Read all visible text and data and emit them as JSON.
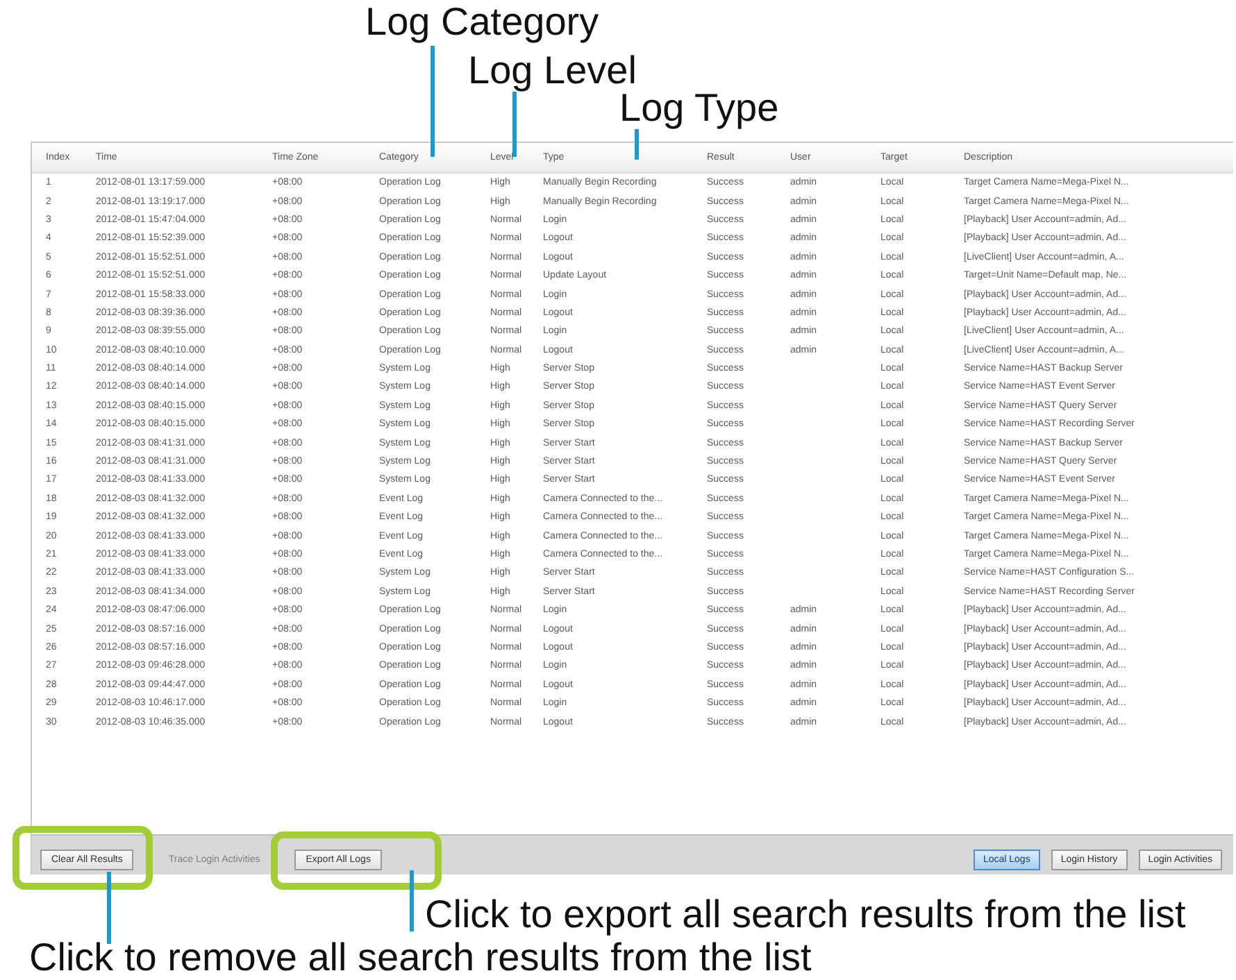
{
  "callouts": [
    {
      "text": "Log Category"
    },
    {
      "text": "Log Level"
    },
    {
      "text": "Log Type"
    }
  ],
  "table": {
    "columns": [
      "Index",
      "Time",
      "Time Zone",
      "Category",
      "Level",
      "Type",
      "Result",
      "User",
      "Target",
      "Description"
    ],
    "rows": [
      {
        "index": "1",
        "time": "2012-08-01 13:17:59.000",
        "time_zone": "+08:00",
        "category": "Operation Log",
        "level": "High",
        "type": "Manually Begin Recording",
        "result": "Success",
        "user": "admin",
        "target": "Local",
        "description": "Target Camera Name=Mega-Pixel N..."
      },
      {
        "index": "2",
        "time": "2012-08-01 13:19:17.000",
        "time_zone": "+08:00",
        "category": "Operation Log",
        "level": "High",
        "type": "Manually Begin Recording",
        "result": "Success",
        "user": "admin",
        "target": "Local",
        "description": "Target Camera Name=Mega-Pixel N..."
      },
      {
        "index": "3",
        "time": "2012-08-01 15:47:04.000",
        "time_zone": "+08:00",
        "category": "Operation Log",
        "level": "Normal",
        "type": "Login",
        "result": "Success",
        "user": "admin",
        "target": "Local",
        "description": "[Playback] User Account=admin, Ad..."
      },
      {
        "index": "4",
        "time": "2012-08-01 15:52:39.000",
        "time_zone": "+08:00",
        "category": "Operation Log",
        "level": "Normal",
        "type": "Logout",
        "result": "Success",
        "user": "admin",
        "target": "Local",
        "description": "[Playback] User Account=admin, Ad..."
      },
      {
        "index": "5",
        "time": "2012-08-01 15:52:51.000",
        "time_zone": "+08:00",
        "category": "Operation Log",
        "level": "Normal",
        "type": "Logout",
        "result": "Success",
        "user": "admin",
        "target": "Local",
        "description": "[LiveClient] User Account=admin, A..."
      },
      {
        "index": "6",
        "time": "2012-08-01 15:52:51.000",
        "time_zone": "+08:00",
        "category": "Operation Log",
        "level": "Normal",
        "type": "Update Layout",
        "result": "Success",
        "user": "admin",
        "target": "Local",
        "description": "Target=Unit Name=Default map, Ne..."
      },
      {
        "index": "7",
        "time": "2012-08-01 15:58:33.000",
        "time_zone": "+08:00",
        "category": "Operation Log",
        "level": "Normal",
        "type": "Login",
        "result": "Success",
        "user": "admin",
        "target": "Local",
        "description": "[Playback] User Account=admin, Ad..."
      },
      {
        "index": "8",
        "time": "2012-08-03 08:39:36.000",
        "time_zone": "+08:00",
        "category": "Operation Log",
        "level": "Normal",
        "type": "Logout",
        "result": "Success",
        "user": "admin",
        "target": "Local",
        "description": "[Playback] User Account=admin, Ad..."
      },
      {
        "index": "9",
        "time": "2012-08-03 08:39:55.000",
        "time_zone": "+08:00",
        "category": "Operation Log",
        "level": "Normal",
        "type": "Login",
        "result": "Success",
        "user": "admin",
        "target": "Local",
        "description": "[LiveClient] User Account=admin, A..."
      },
      {
        "index": "10",
        "time": "2012-08-03 08:40:10.000",
        "time_zone": "+08:00",
        "category": "Operation Log",
        "level": "Normal",
        "type": "Logout",
        "result": "Success",
        "user": "admin",
        "target": "Local",
        "description": "[LiveClient] User Account=admin, A..."
      },
      {
        "index": "11",
        "time": "2012-08-03 08:40:14.000",
        "time_zone": "+08:00",
        "category": "System Log",
        "level": "High",
        "type": "Server Stop",
        "result": "Success",
        "target": "Local",
        "description": "Service Name=HAST Backup Server"
      },
      {
        "index": "12",
        "time": "2012-08-03 08:40:14.000",
        "time_zone": "+08:00",
        "category": "System Log",
        "level": "High",
        "type": "Server Stop",
        "result": "Success",
        "target": "Local",
        "description": "Service Name=HAST Event Server"
      },
      {
        "index": "13",
        "time": "2012-08-03 08:40:15.000",
        "time_zone": "+08:00",
        "category": "System Log",
        "level": "High",
        "type": "Server Stop",
        "result": "Success",
        "target": "Local",
        "description": "Service Name=HAST Query Server"
      },
      {
        "index": "14",
        "time": "2012-08-03 08:40:15.000",
        "time_zone": "+08:00",
        "category": "System Log",
        "level": "High",
        "type": "Server Stop",
        "result": "Success",
        "target": "Local",
        "description": "Service Name=HAST Recording Server"
      },
      {
        "index": "15",
        "time": "2012-08-03 08:41:31.000",
        "time_zone": "+08:00",
        "category": "System Log",
        "level": "High",
        "type": "Server Start",
        "result": "Success",
        "target": "Local",
        "description": "Service Name=HAST Backup Server"
      },
      {
        "index": "16",
        "time": "2012-08-03 08:41:31.000",
        "time_zone": "+08:00",
        "category": "System Log",
        "level": "High",
        "type": "Server Start",
        "result": "Success",
        "target": "Local",
        "description": "Service Name=HAST Query Server"
      },
      {
        "index": "17",
        "time": "2012-08-03 08:41:33.000",
        "time_zone": "+08:00",
        "category": "System Log",
        "level": "High",
        "type": "Server Start",
        "result": "Success",
        "target": "Local",
        "description": "Service Name=HAST Event Server"
      },
      {
        "index": "18",
        "time": "2012-08-03 08:41:32.000",
        "time_zone": "+08:00",
        "category": "Event Log",
        "level": "High",
        "type": "Camera Connected to the...",
        "result": "Success",
        "target": "Local",
        "description": "Target Camera Name=Mega-Pixel N..."
      },
      {
        "index": "19",
        "time": "2012-08-03 08:41:32.000",
        "time_zone": "+08:00",
        "category": "Event Log",
        "level": "High",
        "type": "Camera Connected to the...",
        "result": "Success",
        "target": "Local",
        "description": "Target Camera Name=Mega-Pixel N..."
      },
      {
        "index": "20",
        "time": "2012-08-03 08:41:33.000",
        "time_zone": "+08:00",
        "category": "Event Log",
        "level": "High",
        "type": "Camera Connected to the...",
        "result": "Success",
        "target": "Local",
        "description": "Target Camera Name=Mega-Pixel N..."
      },
      {
        "index": "21",
        "time": "2012-08-03 08:41:33.000",
        "time_zone": "+08:00",
        "category": "Event Log",
        "level": "High",
        "type": "Camera Connected to the...",
        "result": "Success",
        "target": "Local",
        "description": "Target Camera Name=Mega-Pixel N..."
      },
      {
        "index": "22",
        "time": "2012-08-03 08:41:33.000",
        "time_zone": "+08:00",
        "category": "System Log",
        "level": "High",
        "type": "Server Start",
        "result": "Success",
        "target": "Local",
        "description": "Service Name=HAST Configuration S..."
      },
      {
        "index": "23",
        "time": "2012-08-03 08:41:34.000",
        "time_zone": "+08:00",
        "category": "System Log",
        "level": "High",
        "type": "Server Start",
        "result": "Success",
        "target": "Local",
        "description": "Service Name=HAST Recording Server"
      },
      {
        "index": "24",
        "time": "2012-08-03 08:47:06.000",
        "time_zone": "+08:00",
        "category": "Operation Log",
        "level": "Normal",
        "type": "Login",
        "result": "Success",
        "user": "admin",
        "target": "Local",
        "description": "[Playback] User Account=admin, Ad..."
      },
      {
        "index": "25",
        "time": "2012-08-03 08:57:16.000",
        "time_zone": "+08:00",
        "category": "Operation Log",
        "level": "Normal",
        "type": "Logout",
        "result": "Success",
        "user": "admin",
        "target": "Local",
        "description": "[Playback] User Account=admin, Ad..."
      },
      {
        "index": "26",
        "time": "2012-08-03 08:57:16.000",
        "time_zone": "+08:00",
        "category": "Operation Log",
        "level": "Normal",
        "type": "Logout",
        "result": "Success",
        "user": "admin",
        "target": "Local",
        "description": "[Playback] User Account=admin, Ad..."
      },
      {
        "index": "27",
        "time": "2012-08-03 09:46:28.000",
        "time_zone": "+08:00",
        "category": "Operation Log",
        "level": "Normal",
        "type": "Login",
        "result": "Success",
        "user": "admin",
        "target": "Local",
        "description": "[Playback] User Account=admin, Ad..."
      },
      {
        "index": "28",
        "time": "2012-08-03 09:44:47.000",
        "time_zone": "+08:00",
        "category": "Operation Log",
        "level": "Normal",
        "type": "Logout",
        "result": "Success",
        "user": "admin",
        "target": "Local",
        "description": "[Playback] User Account=admin, Ad..."
      },
      {
        "index": "29",
        "time": "2012-08-03 10:46:17.000",
        "time_zone": "+08:00",
        "category": "Operation Log",
        "level": "Normal",
        "type": "Login",
        "result": "Success",
        "user": "admin",
        "target": "Local",
        "description": "[Playback] User Account=admin, Ad..."
      },
      {
        "index": "30",
        "time": "2012-08-03 10:46:35.000",
        "time_zone": "+08:00",
        "category": "Operation Log",
        "level": "Normal",
        "type": "Logout",
        "result": "Success",
        "user": "admin",
        "target": "Local",
        "description": "[Playback] User Account=admin, Ad..."
      }
    ]
  },
  "toolbar": {
    "buttons": [
      {
        "label": "Clear All Results",
        "disabled": false,
        "highlighted": true
      },
      {
        "label": "Trace Login Activities",
        "disabled": true,
        "highlighted": false
      },
      {
        "label": "Export All Logs",
        "disabled": false,
        "highlighted": true
      }
    ],
    "tabs": [
      {
        "label": "Local Logs",
        "selected": true
      },
      {
        "label": "Login History",
        "selected": false
      },
      {
        "label": "Login Activities",
        "selected": false
      }
    ]
  },
  "notes": [
    {
      "text": "Click to export all search results from the list"
    },
    {
      "text": "Click to remove all search results from the list"
    }
  ]
}
